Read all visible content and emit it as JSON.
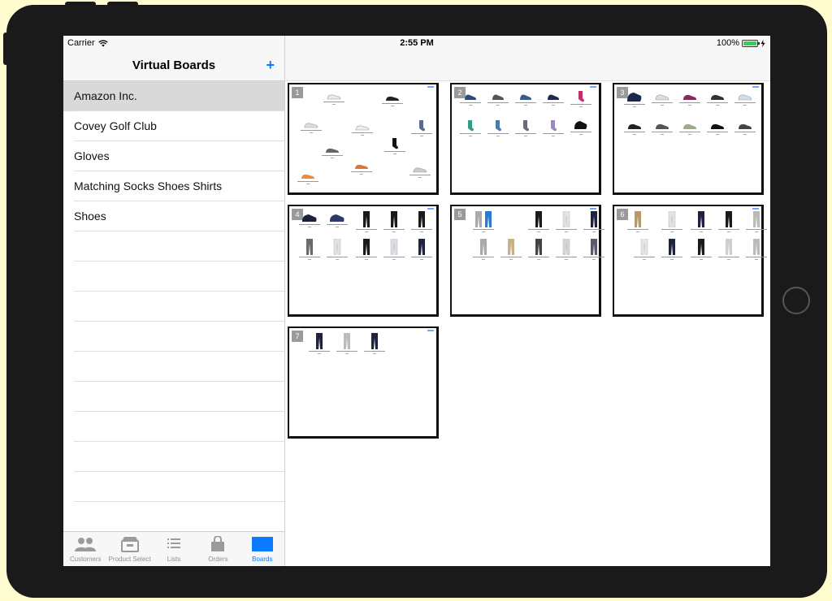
{
  "status_bar": {
    "carrier": "Carrier",
    "time": "2:55 PM",
    "battery": "100%"
  },
  "master": {
    "title": "Virtual Boards",
    "add_label": "+",
    "items": [
      {
        "label": "Amazon Inc."
      },
      {
        "label": "Covey Golf Club"
      },
      {
        "label": "Gloves"
      },
      {
        "label": "Matching Socks Shoes Shirts"
      },
      {
        "label": "Shoes"
      }
    ]
  },
  "tabs": [
    {
      "label": "Customers",
      "icon": "customers-icon"
    },
    {
      "label": "Product Select",
      "icon": "product-select-icon"
    },
    {
      "label": "Lists",
      "icon": "lists-icon"
    },
    {
      "label": "Orders",
      "icon": "orders-icon"
    },
    {
      "label": "Boards",
      "icon": "boards-icon"
    }
  ],
  "active_tab": "Boards",
  "boards": [
    {
      "number": "1"
    },
    {
      "number": "2"
    },
    {
      "number": "3"
    },
    {
      "number": "4"
    },
    {
      "number": "5"
    },
    {
      "number": "6"
    },
    {
      "number": "7"
    }
  ],
  "colors": {
    "accent": "#0a7aff",
    "selected_row": "#d9d9d9",
    "battery": "#2fd34d"
  }
}
